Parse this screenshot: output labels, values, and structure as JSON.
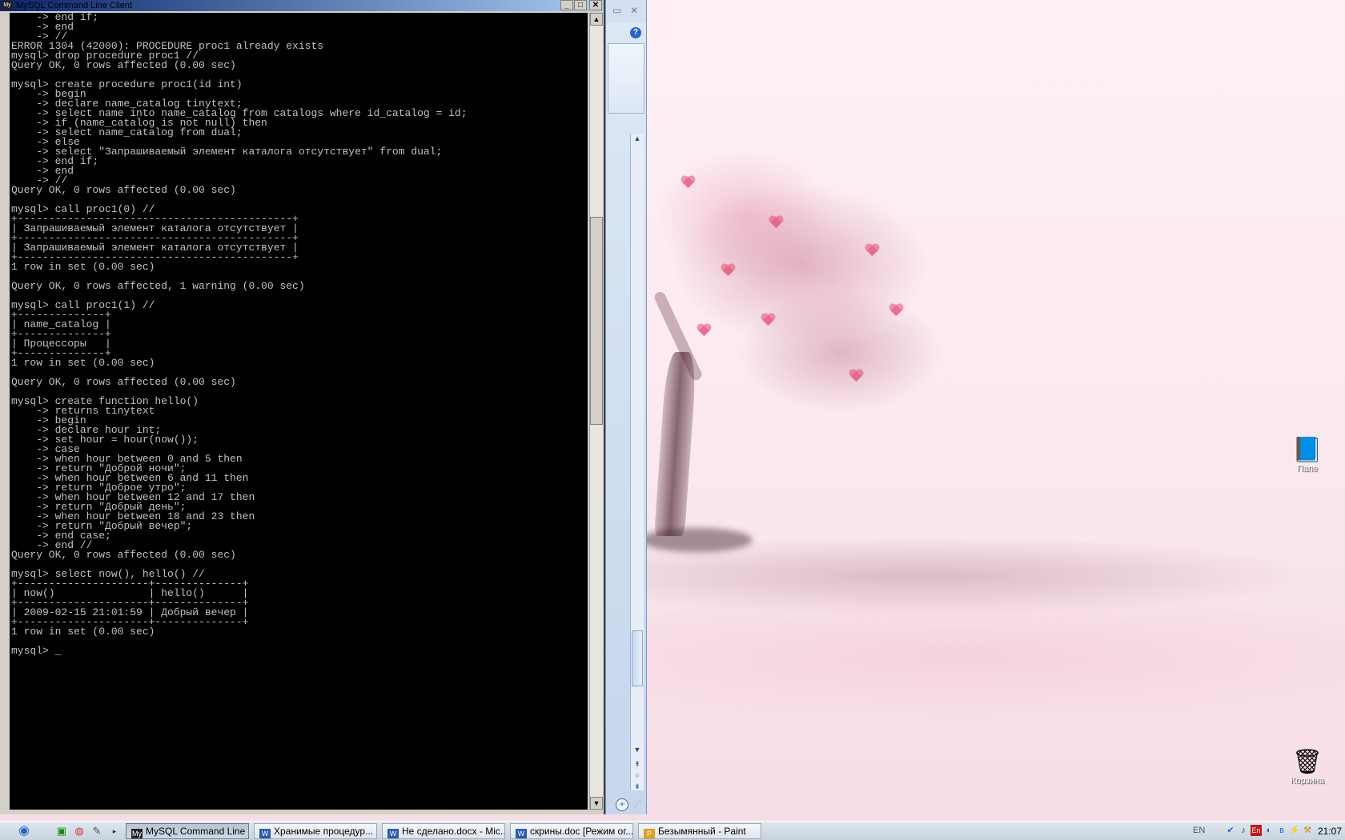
{
  "window": {
    "title": "MySQL Command Line Client",
    "controls": {
      "minimize": "_",
      "maximize": "□",
      "close": "✕"
    }
  },
  "console": {
    "lines": [
      "    -> end if;",
      "    -> end",
      "    -> //",
      "ERROR 1304 (42000): PROCEDURE proc1 already exists",
      "mysql> drop procedure proc1 //",
      "Query OK, 0 rows affected (0.00 sec)",
      "",
      "mysql> create procedure proc1(id int)",
      "    -> begin",
      "    -> declare name_catalog tinytext;",
      "    -> select name into name_catalog from catalogs where id_catalog = id;",
      "    -> if (name_catalog is not null) then",
      "    -> select name_catalog from dual;",
      "    -> else",
      "    -> select \"Запрашиваемый элемент каталога отсутствует\" from dual;",
      "    -> end if;",
      "    -> end",
      "    -> //",
      "Query OK, 0 rows affected (0.00 sec)",
      "",
      "mysql> call proc1(0) //",
      "+--------------------------------------------+",
      "| Запрашиваемый элемент каталога отсутствует |",
      "+--------------------------------------------+",
      "| Запрашиваемый элемент каталога отсутствует |",
      "+--------------------------------------------+",
      "1 row in set (0.00 sec)",
      "",
      "Query OK, 0 rows affected, 1 warning (0.00 sec)",
      "",
      "mysql> call proc1(1) //",
      "+--------------+",
      "| name_catalog |",
      "+--------------+",
      "| Процессоры   |",
      "+--------------+",
      "1 row in set (0.00 sec)",
      "",
      "Query OK, 0 rows affected (0.00 sec)",
      "",
      "mysql> create function hello()",
      "    -> returns tinytext",
      "    -> begin",
      "    -> declare hour int;",
      "    -> set hour = hour(now());",
      "    -> case",
      "    -> when hour between 0 and 5 then",
      "    -> return \"Доброй ночи\";",
      "    -> when hour between 6 and 11 then",
      "    -> return \"Доброе утро\";",
      "    -> when hour between 12 and 17 then",
      "    -> return \"Добрый день\";",
      "    -> when hour between 18 and 23 then",
      "    -> return \"Добрый вечер\";",
      "    -> end case;",
      "    -> end //",
      "Query OK, 0 rows affected (0.00 sec)",
      "",
      "mysql> select now(), hello() //",
      "+---------------------+--------------+",
      "| now()               | hello()      |",
      "+---------------------+--------------+",
      "| 2009-02-15 21:01:59 | Добрый вечер |",
      "+---------------------+--------------+",
      "1 row in set (0.00 sec)",
      "",
      "mysql> _"
    ],
    "scrollbar": {
      "up": "▲",
      "down": "▼"
    }
  },
  "word": {
    "help": "?",
    "nav_up": "⇞",
    "nav_select": "○",
    "nav_down": "⇟",
    "zoom_in": "+"
  },
  "desktop": {
    "icons": [
      {
        "label": "Папе",
        "icon": "book-icon"
      },
      {
        "label": "Корзина",
        "icon": "recycle-bin-icon"
      }
    ]
  },
  "taskbar": {
    "tasks": [
      {
        "label": "MySQL Command Line ...",
        "icon": "mysql-icon",
        "active": true
      },
      {
        "label": "Хранимые процедур...",
        "icon": "word-icon",
        "active": false
      },
      {
        "label": "Не сделано.docx - Mic...",
        "icon": "word-icon",
        "active": false
      },
      {
        "label": "скрины.doc [Режим ог...",
        "icon": "word-icon",
        "active": false
      },
      {
        "label": "Безымянный - Paint",
        "icon": "paint-icon",
        "active": false
      }
    ],
    "language": "EN",
    "tray_lang_badge": "En",
    "clock": "21:07"
  },
  "colors": {
    "console_bg": "#000000",
    "console_fg": "#c0c0c0",
    "wallpaper": "#fbe9ef",
    "accent": "#2a64c8"
  }
}
